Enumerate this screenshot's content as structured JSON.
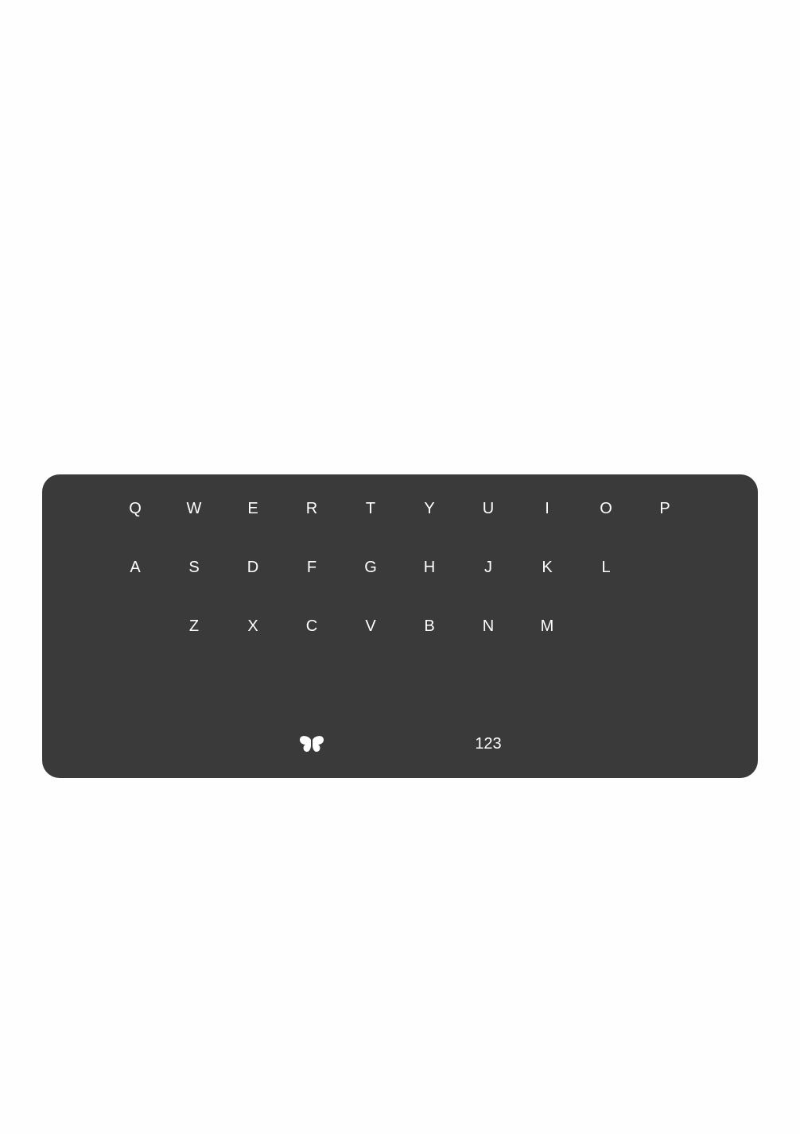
{
  "keyboard": {
    "rows": [
      [
        "Q",
        "W",
        "E",
        "R",
        "T",
        "Y",
        "U",
        "I",
        "O",
        "P"
      ],
      [
        "A",
        "S",
        "D",
        "F",
        "G",
        "H",
        "J",
        "K",
        "L"
      ],
      [
        "Z",
        "X",
        "C",
        "V",
        "B",
        "N",
        "M"
      ]
    ],
    "bottom_bar": {
      "logo_icon": "butterfly-icon",
      "numbers_label": "123"
    }
  },
  "colors": {
    "page_background": "#fefefe",
    "keyboard_background": "#3a3a3a",
    "key_text": "#ffffff"
  }
}
